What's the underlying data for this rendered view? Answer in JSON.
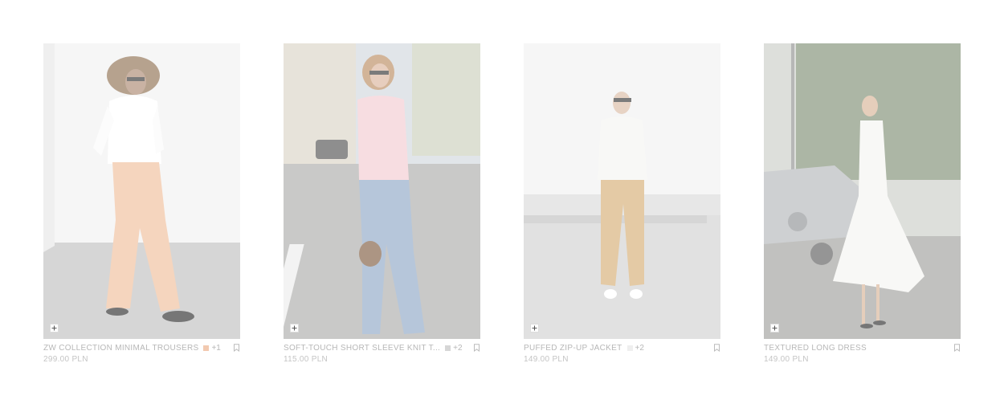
{
  "products": [
    {
      "name": "ZW COLLECTION MINIMAL TROUSERS",
      "more_colors": "+1",
      "swatch_color": "#f2c9b0",
      "price": "299.00 PLN",
      "image": "woman-white-shirt-peach-trousers"
    },
    {
      "name": "SOFT-TOUCH SHORT SLEEVE KNIT T...",
      "more_colors": "+2",
      "swatch_color": "#d6d6d6",
      "price": "115.00 PLN",
      "image": "woman-pink-top-jeans-street"
    },
    {
      "name": "PUFFED ZIP-UP JACKET",
      "more_colors": "+2",
      "swatch_color": "#efefef",
      "price": "149.00 PLN",
      "image": "woman-white-jacket-beige-trousers"
    },
    {
      "name": "TEXTURED LONG DRESS",
      "more_colors": "",
      "swatch_color": "",
      "price": "149.00 PLN",
      "image": "woman-white-long-dress-car"
    }
  ],
  "icons": {
    "add": "plus-icon",
    "save": "bookmark-icon"
  }
}
